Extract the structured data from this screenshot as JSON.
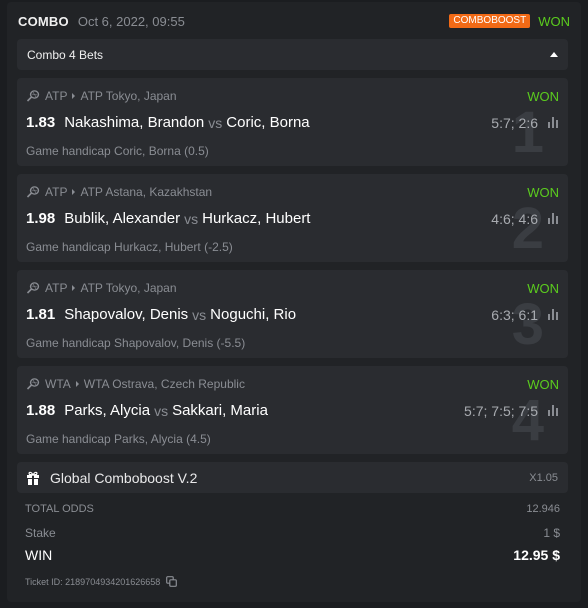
{
  "header": {
    "title": "COMBO",
    "date": "Oct 6, 2022, 09:55",
    "badge": "COMBOBOOST",
    "status": "WON"
  },
  "bets_bar": {
    "label": "Combo 4 Bets"
  },
  "bets": [
    {
      "index": "1",
      "tour": "ATP",
      "tournament": "ATP Tokyo, Japan",
      "status": "WON",
      "odds": "1.83",
      "player1": "Nakashima, Brandon",
      "vs": "vs",
      "player2": "Coric, Borna",
      "score": "5:7; 2:6",
      "market": "Game handicap Coric, Borna (0.5)"
    },
    {
      "index": "2",
      "tour": "ATP",
      "tournament": "ATP Astana, Kazakhstan",
      "status": "WON",
      "odds": "1.98",
      "player1": "Bublik, Alexander",
      "vs": "vs",
      "player2": "Hurkacz, Hubert",
      "score": "4:6; 4:6",
      "market": "Game handicap Hurkacz, Hubert (-2.5)"
    },
    {
      "index": "3",
      "tour": "ATP",
      "tournament": "ATP Tokyo, Japan",
      "status": "WON",
      "odds": "1.81",
      "player1": "Shapovalov, Denis",
      "vs": "vs",
      "player2": "Noguchi, Rio",
      "score": "6:3; 6:1",
      "market": "Game handicap Shapovalov, Denis (-5.5)"
    },
    {
      "index": "4",
      "tour": "WTA",
      "tournament": "WTA Ostrava, Czech Republic",
      "status": "WON",
      "odds": "1.88",
      "player1": "Parks, Alycia",
      "vs": "vs",
      "player2": "Sakkari, Maria",
      "score": "5:7; 7:5; 7:5",
      "market": "Game handicap Parks, Alycia (4.5)"
    }
  ],
  "boost": {
    "name": "Global Comboboost V.2",
    "multiplier": "X1.05"
  },
  "summary": {
    "total_odds_label": "TOTAL ODDS",
    "total_odds_value": "12.946",
    "stake_label": "Stake",
    "stake_value": "1 $",
    "win_label": "WIN",
    "win_value": "12.95 $"
  },
  "ticket": {
    "text": "Ticket ID: 2189704934201626658"
  },
  "colors": {
    "won": "#5bcc1e",
    "badge": "#f26a16",
    "background": "#1b1d20",
    "panel": "#2a2c30"
  }
}
